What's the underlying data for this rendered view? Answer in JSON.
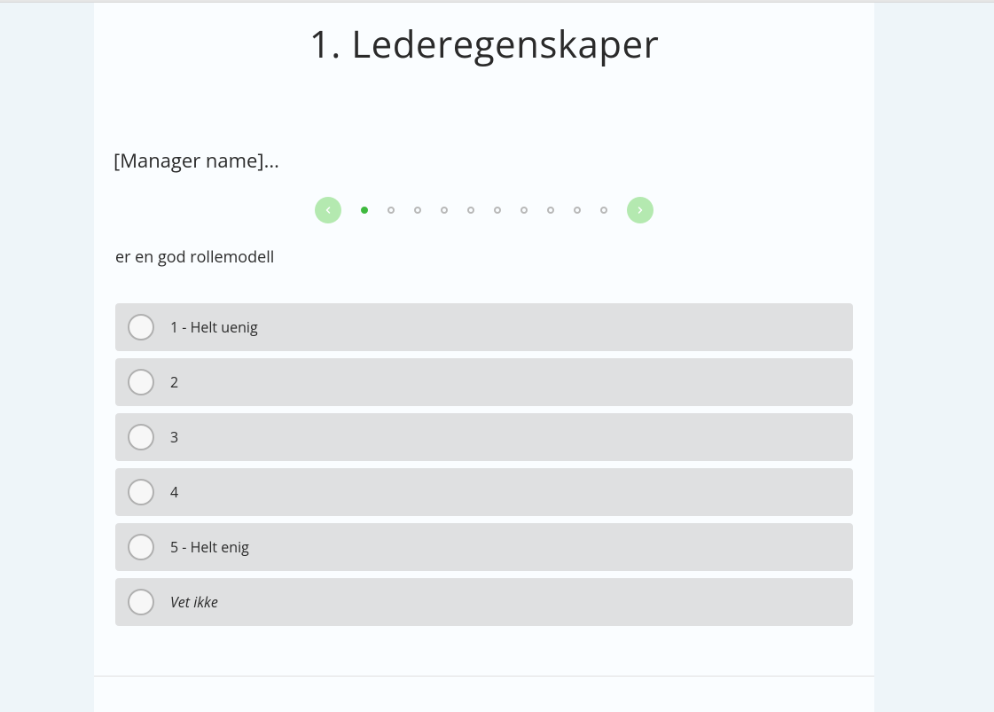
{
  "header": {
    "title": "1. Lederegenskaper"
  },
  "subject_prefix": "[Manager name]...",
  "pager": {
    "total": 10,
    "current": 1
  },
  "question": "er en god rollemodell",
  "options": [
    {
      "label": "1 - Helt uenig",
      "italic": false
    },
    {
      "label": "2",
      "italic": false
    },
    {
      "label": "3",
      "italic": false
    },
    {
      "label": "4",
      "italic": false
    },
    {
      "label": "5 - Helt enig",
      "italic": false
    },
    {
      "label": "Vet ikke",
      "italic": true
    }
  ],
  "colors": {
    "accent": "#3fb93f",
    "nav_bg": "#a8e6a3",
    "option_bg": "#dfe0e1",
    "page_bg": "#eef5f9"
  }
}
